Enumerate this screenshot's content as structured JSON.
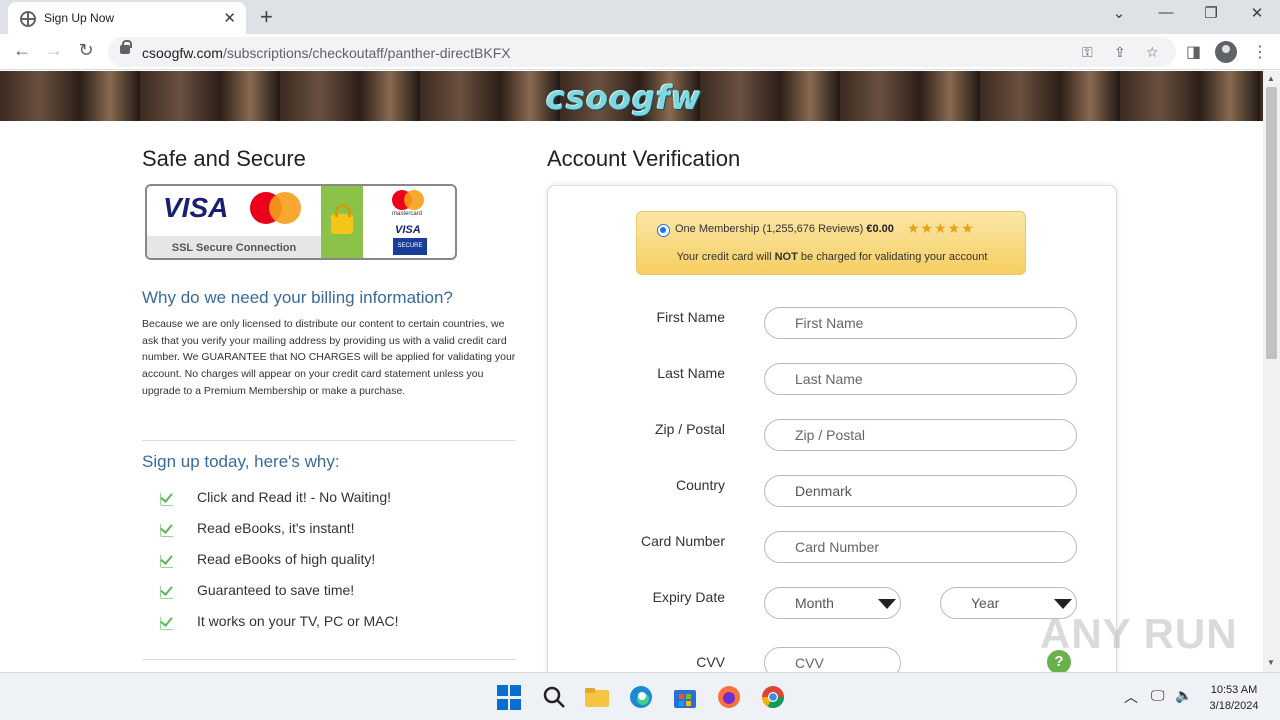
{
  "browser": {
    "tab_title": "Sign Up Now",
    "tab_close": "✕",
    "new_tab": "+",
    "url_domain": "csoogfw.com",
    "url_path": "/subscriptions/checkoutaff/panther-directBKFX",
    "window_controls": [
      "⌄",
      "—",
      "❐",
      "✕"
    ]
  },
  "page": {
    "logo": "csoogfw",
    "left_title": "Safe and Secure",
    "right_title": "Account Verification",
    "ssl": {
      "visa": "VISA",
      "ssl_label": "SSL Secure Connection",
      "mastercard_small": "mastercard",
      "visa_small": "VISA",
      "secure": "SECURE"
    },
    "why_heading": "Why do we need your billing information?",
    "why_text": "Because we are only licensed to distribute our content to certain countries, we ask that you verify your mailing address by providing us with a valid credit card number. We GUARANTEE that NO CHARGES will be applied for validating your account. No charges will appear on your credit card statement unless you upgrade to a Premium Membership or make a purchase.",
    "signup_heading": "Sign up today, here's why:",
    "benefits": [
      "Click and Read it! - No Waiting!",
      "Read eBooks, it's instant!",
      "Read eBooks of high quality!",
      "Guaranteed to save time!",
      "It works on your TV, PC or MAC!"
    ],
    "offer": {
      "plan": "One Membership",
      "reviews": "(1,255,676 Reviews)",
      "price": "€0.00",
      "stars": "★★★★★",
      "note_before": "Your credit card will ",
      "note_bold": "NOT",
      "note_after": " be charged for validating your account"
    },
    "form": {
      "first_name_label": "First Name",
      "first_name_placeholder": "First Name",
      "last_name_label": "Last Name",
      "last_name_placeholder": "Last Name",
      "zip_label": "Zip / Postal",
      "zip_placeholder": "Zip / Postal",
      "country_label": "Country",
      "country_value": "Denmark",
      "card_label": "Card Number",
      "card_placeholder": "Card Number",
      "expiry_label": "Expiry Date",
      "month": "Month",
      "year": "Year",
      "cvv_label": "CVV",
      "cvv_placeholder": "CVV",
      "help": "?"
    },
    "watermark": "ANY RUN"
  },
  "taskbar": {
    "time": "10:53 AM",
    "date": "3/18/2024"
  },
  "colors": {
    "link_blue": "#3a6b96",
    "offer_yellow": "#f6cf62",
    "check_green": "#5cb85c",
    "help_green": "#6ab04c"
  }
}
